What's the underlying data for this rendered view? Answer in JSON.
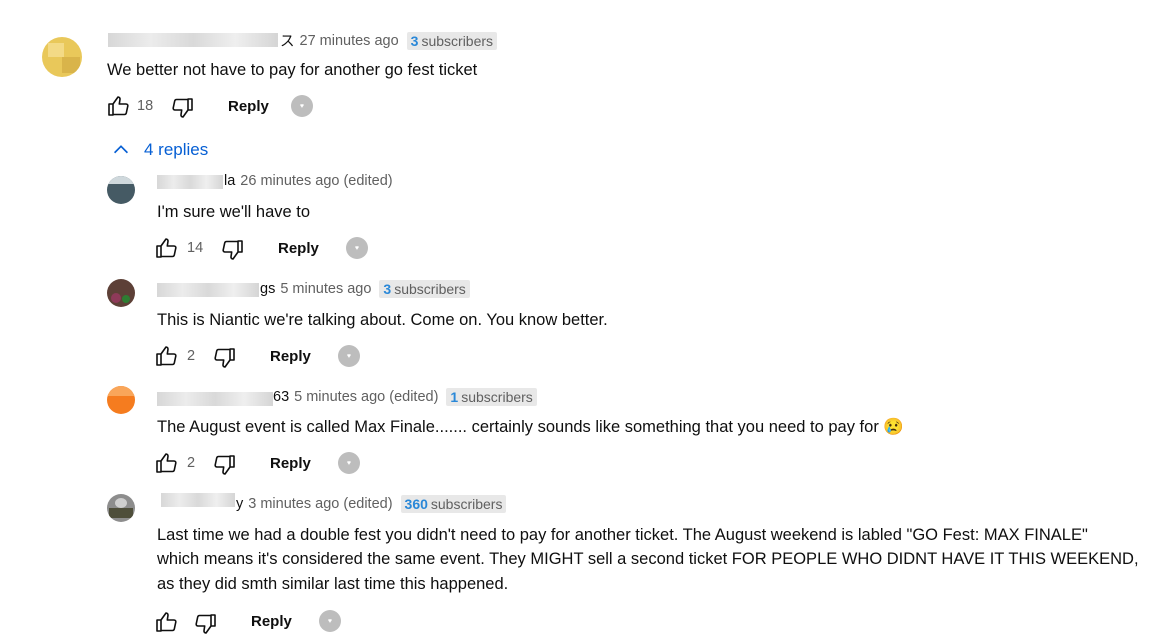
{
  "top_comment": {
    "author_fragment": "ス",
    "time": "27 minutes ago",
    "subs_count": "3",
    "subs_label": "subscribers",
    "text": "We better not have to pay for another go fest ticket",
    "likes": "18",
    "reply_label": "Reply"
  },
  "replies_toggle": {
    "label": "4 replies"
  },
  "replies": [
    {
      "author_fragment": "la",
      "time": "26 minutes ago (edited)",
      "text": "I'm sure we'll have to",
      "likes": "14",
      "reply_label": "Reply"
    },
    {
      "author_fragment": "gs",
      "time": "5 minutes ago",
      "subs_count": "3",
      "subs_label": "subscribers",
      "text": "This is Niantic we're talking about. Come on. You know better.",
      "likes": "2",
      "reply_label": "Reply"
    },
    {
      "author_fragment": "63",
      "time": "5 minutes ago (edited)",
      "subs_count": "1",
      "subs_label": "subscribers",
      "text": "The August event is called Max Finale....... certainly sounds like something that you need to pay for 😢",
      "likes": "2",
      "reply_label": "Reply"
    },
    {
      "author_fragment": "y",
      "time": "3 minutes ago (edited)",
      "subs_count": "360",
      "subs_label": "subscribers",
      "text_lines": [
        "Last time we had a double fest you didn't need to pay for another ticket. The August weekend is labled \"GO Fest: MAX FINALE\"",
        "which means it's considered the same event. They MIGHT sell a second ticket FOR PEOPLE WHO DIDNT HAVE IT THIS WEEKEND,",
        "as they did smth similar last time this happened."
      ],
      "likes": "",
      "reply_label": "Reply"
    }
  ],
  "colors": {
    "link_blue": "#065fd4",
    "badge_blue": "#2a88d8",
    "meta_gray": "#606060"
  },
  "icons": [
    "like-icon",
    "dislike-icon",
    "creator-heart-icon",
    "chevron-up-icon"
  ]
}
